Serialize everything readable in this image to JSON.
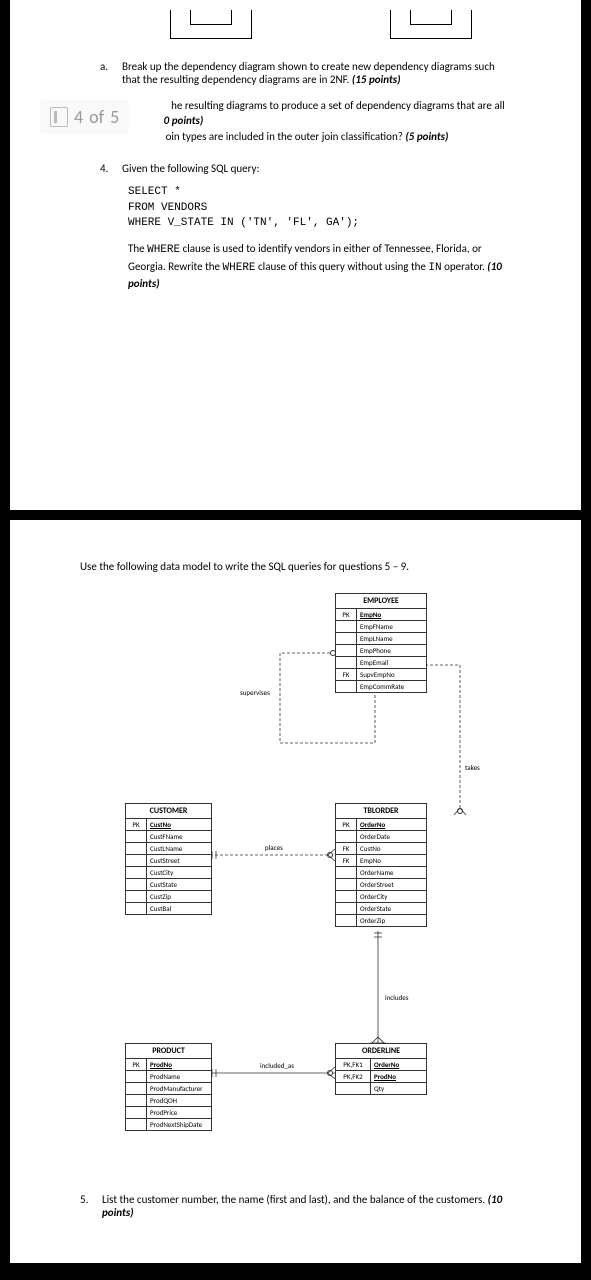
{
  "page_indicator": {
    "current": "4",
    "of_label": "of",
    "total": "5"
  },
  "page1": {
    "item_a": {
      "letter": "a.",
      "text_1": "Break up the dependency diagram shown to create new dependency diagrams such that the resulting dependency diagrams are in 2NF. ",
      "points": "(15 points)"
    },
    "item_b": {
      "text_1": "he resulting diagrams to produce a set of dependency diagrams that are all ",
      "points": "0 points)"
    },
    "item_c": {
      "text_1": "oin types are included in the outer join classification? ",
      "points": "(5 points)"
    },
    "q4": {
      "num": "4.",
      "text": "Given the following SQL query:"
    },
    "sql": {
      "l1": "SELECT *",
      "l2": "FROM VENDORS",
      "l3": "WHERE V_STATE IN ('TN', 'FL', GA');"
    },
    "explain": {
      "t1": "The ",
      "c1": "WHERE",
      "t2": " clause is used to identify vendors in either of Tennessee, Florida, or Georgia. Rewrite the ",
      "c2": "WHERE",
      "t3": " clause of this query without using the ",
      "c3": "IN",
      "t4": " operator. ",
      "points": "(10 points)"
    }
  },
  "page2": {
    "intro": "Use the following data model to write the SQL queries for questions 5 – 9.",
    "q5": {
      "num": "5.",
      "text": "List the customer number, the name (first and last), and the balance of the customers. ",
      "points": "(10 points)"
    }
  },
  "entities": {
    "employee": {
      "title": "EMPLOYEE",
      "rows": [
        {
          "key": "PK",
          "attr": "EmpNo",
          "pk": true
        },
        {
          "key": "",
          "attr": "EmpFName"
        },
        {
          "key": "",
          "attr": "EmpLName"
        },
        {
          "key": "",
          "attr": "EmpPhone"
        },
        {
          "key": "",
          "attr": "EmpEmail"
        },
        {
          "key": "FK",
          "attr": "SupvEmpNo"
        },
        {
          "key": "",
          "attr": "EmpCommRate"
        }
      ]
    },
    "customer": {
      "title": "CUSTOMER",
      "rows": [
        {
          "key": "PK",
          "attr": "CustNo",
          "pk": true
        },
        {
          "key": "",
          "attr": "CustFName"
        },
        {
          "key": "",
          "attr": "CustLName"
        },
        {
          "key": "",
          "attr": "CustStreet"
        },
        {
          "key": "",
          "attr": "CustCity"
        },
        {
          "key": "",
          "attr": "CustState"
        },
        {
          "key": "",
          "attr": "CustZip"
        },
        {
          "key": "",
          "attr": "CustBal"
        }
      ]
    },
    "tblorder": {
      "title": "TBLORDER",
      "rows": [
        {
          "key": "PK",
          "attr": "OrderNo",
          "pk": true
        },
        {
          "key": "",
          "attr": "OrderDate"
        },
        {
          "key": "FK",
          "attr": "CustNo"
        },
        {
          "key": "FK",
          "attr": "EmpNo"
        },
        {
          "key": "",
          "attr": "OrderName"
        },
        {
          "key": "",
          "attr": "OrderStreet"
        },
        {
          "key": "",
          "attr": "OrderCity"
        },
        {
          "key": "",
          "attr": "OrderState"
        },
        {
          "key": "",
          "attr": "OrderZip"
        }
      ]
    },
    "product": {
      "title": "PRODUCT",
      "rows": [
        {
          "key": "PK",
          "attr": "ProdNo",
          "pk": true
        },
        {
          "key": "",
          "attr": "ProdName"
        },
        {
          "key": "",
          "attr": "ProdManufacturer"
        },
        {
          "key": "",
          "attr": "ProdQOH"
        },
        {
          "key": "",
          "attr": "ProdPrice"
        },
        {
          "key": "",
          "attr": "ProdNextShipDate"
        }
      ]
    },
    "orderline": {
      "title": "ORDERLINE",
      "rows": [
        {
          "key": "PK,FK1",
          "attr": "OrderNo",
          "pk": true
        },
        {
          "key": "PK,FK2",
          "attr": "ProdNo",
          "pk": true
        },
        {
          "key": "",
          "attr": "Qty"
        }
      ]
    }
  },
  "relations": {
    "supervises": "supervises",
    "takes": "takes",
    "places": "places",
    "includes": "includes",
    "included_as": "included_as"
  }
}
